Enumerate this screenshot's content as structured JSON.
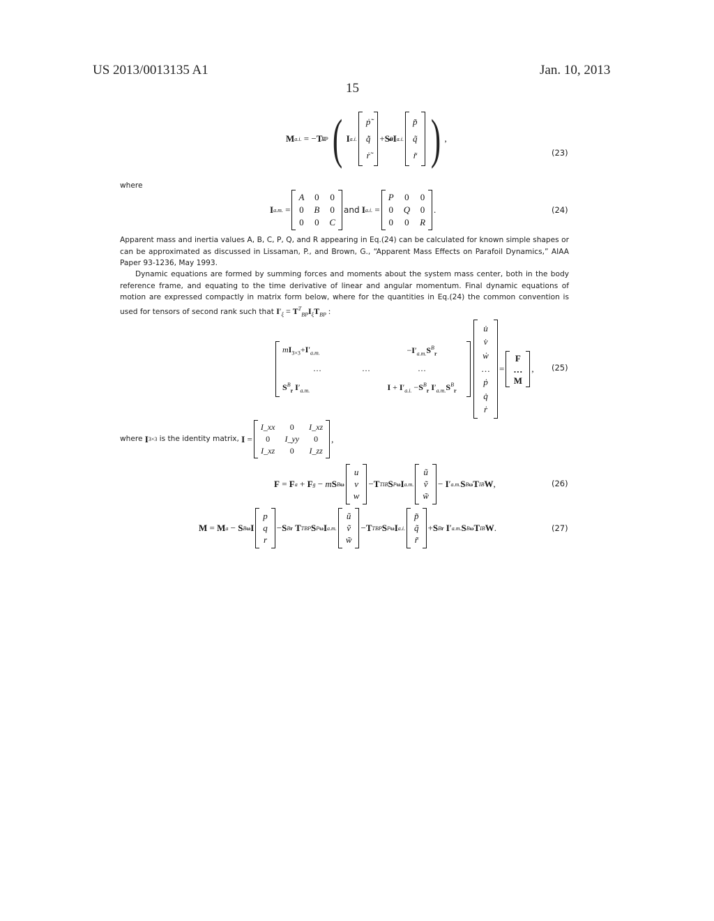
{
  "header": {
    "publication_number": "US 2013/0013135 A1",
    "date": "Jan. 10, 2013",
    "page_number": "15"
  },
  "equations": {
    "eq23": {
      "number": "(23)",
      "lhs": "M",
      "lhs_sub": "a.i.",
      "vector1": [
        "ṗ̃",
        "q̃̇",
        "ṙ̃"
      ],
      "vector2": [
        "p̃",
        "q̃",
        "r̃"
      ]
    },
    "eq24": {
      "number": "(24)",
      "matrix_am": [
        [
          "A",
          "0",
          "0"
        ],
        [
          "0",
          "B",
          "0"
        ],
        [
          "0",
          "0",
          "C"
        ]
      ],
      "and_label": "and",
      "matrix_ai": [
        [
          "P",
          "0",
          "0"
        ],
        [
          "0",
          "Q",
          "0"
        ],
        [
          "0",
          "0",
          "R"
        ]
      ]
    },
    "eq25": {
      "number": "(25)",
      "state_vector": [
        "u̇",
        "v̇",
        "ẇ",
        "…",
        "ṗ",
        "q̇",
        "ṙ"
      ],
      "rhs_vector": [
        "F",
        "…",
        "M"
      ],
      "dots": "…"
    },
    "eq26": {
      "number": "(26)",
      "vec_uvw": [
        "u",
        "v",
        "w"
      ],
      "vec_tilde": [
        "ũ",
        "ṽ",
        "w̃"
      ]
    },
    "eq27": {
      "number": "(27)",
      "vec_pqr": [
        "p",
        "q",
        "r"
      ],
      "vec_tilde_uvw": [
        "ũ",
        "ṽ",
        "w̃"
      ],
      "vec_tilde_pqr": [
        "p̃",
        "q̃",
        "r̃"
      ]
    }
  },
  "text": {
    "where1": "where",
    "para1": "Apparent mass and inertia values A, B, C, P, Q, and R appearing in Eq.(24) can be calculated for known simple shapes or can be approximated as discussed in Lissaman, P., and Brown, G., “Apparent Mass Effects on Parafoil Dynamics,” AIAA Paper 93-1236, May 1993.",
    "para2": "Dynamic equations are formed by summing forces and moments about the system mass center, both in the body reference frame, and equating to the time derivative of linear and angular momentum. Final dynamic equations of motion are expressed compactly in matrix form below, where for the quantities in Eq.(24) the common convention is used for tensors of second rank such that",
    "where2_a": "where",
    "where2_b": "is the identity matrix,",
    "inertia_matrix": [
      [
        "I_xx",
        "0",
        "I_xz"
      ],
      [
        "0",
        "I_yy",
        "0"
      ],
      [
        "I_xz",
        "0",
        "I_zz"
      ]
    ]
  }
}
